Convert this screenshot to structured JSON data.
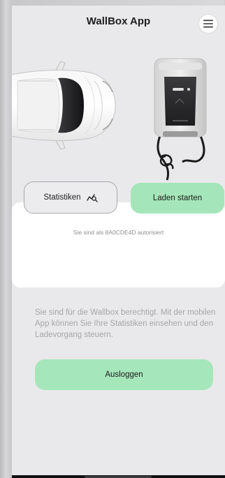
{
  "header": {
    "title": "WallBox App",
    "menu_icon": "hamburger-menu-icon"
  },
  "actions": {
    "stats_label": "Statistiken",
    "stats_icon": "chart-search-icon",
    "start_label": "Laden starten"
  },
  "status": {
    "authorized_text": "Sie sind als 8A0CDE4D autorisiert"
  },
  "info": {
    "description": "Sie sind für die Wallbox berechtigt. Mit der mobilen App können Sie Ihre Statistiken einsehen und den Ladevorgang steuern."
  },
  "logout": {
    "label": "Ausloggen"
  },
  "colors": {
    "accent_green": "#a4e6b9",
    "background": "#e9e9eb",
    "card": "#ffffff",
    "muted_text": "#a6a6aa"
  }
}
